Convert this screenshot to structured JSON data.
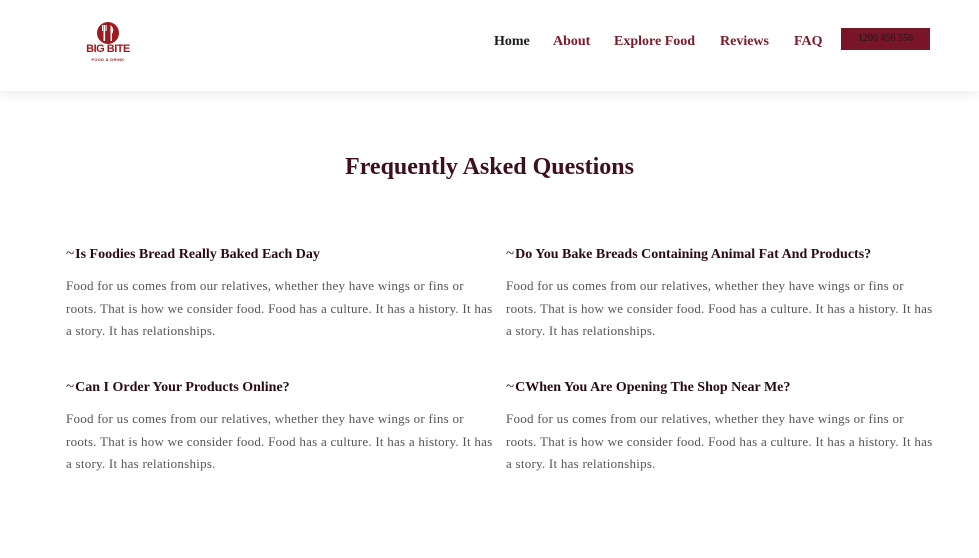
{
  "logo": {
    "word": "BIG BITE",
    "tagline": "FOOD & DRINK",
    "icon": "fork-knife-icon",
    "color": "#9b1b1f"
  },
  "nav": {
    "items": [
      {
        "label": "Home",
        "active": true
      },
      {
        "label": "About",
        "active": false
      },
      {
        "label": "Explore Food",
        "active": false
      },
      {
        "label": "Reviews",
        "active": false
      },
      {
        "label": "FAQ",
        "active": false
      }
    ],
    "phone": "1200 456 556"
  },
  "faq": {
    "title": "Frequently Asked Questions",
    "toggle_icon": "~",
    "items": [
      {
        "question": "Is Foodies Bread Really Baked Each Day",
        "answer": "Food for us comes from our relatives, whether they have wings or fins or roots. That is how we consider food. Food has a culture. It has a history. It has a story. It has relationships."
      },
      {
        "question": "Do You Bake Breads Containing Animal Fat And Products?",
        "answer": "Food for us comes from our relatives, whether they have wings or fins or roots. That is how we consider food. Food has a culture. It has a history. It has a story. It has relationships."
      },
      {
        "question": "Can I Order Your Products Online?",
        "answer": "Food for us comes from our relatives, whether they have wings or fins or roots. That is how we consider food. Food has a culture. It has a history. It has a story. It has relationships."
      },
      {
        "question": "CWhen You Are Opening The Shop Near Me?",
        "answer": "Food for us comes from our relatives, whether they have wings or fins or roots. That is how we consider food. Food has a culture. It has a history. It has a story. It has relationships."
      }
    ]
  },
  "colors": {
    "brand": "#7a1428",
    "nav_link": "#7c1a2a",
    "heading": "#3e0f1c",
    "body_text": "#555555"
  }
}
